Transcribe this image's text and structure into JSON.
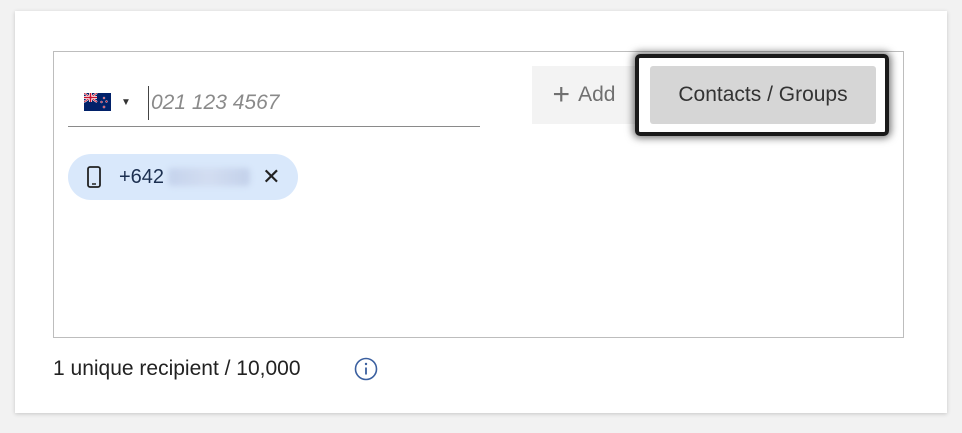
{
  "phone_input": {
    "country_flag": "new-zealand-flag-icon",
    "placeholder": "021 123 4567"
  },
  "add_button": {
    "icon": "plus-icon",
    "label": "Add"
  },
  "contacts_button": {
    "label": "Contacts / Groups"
  },
  "recipients": [
    {
      "icon": "mobile-phone-icon",
      "number": "+642"
    }
  ],
  "footer": {
    "count_text": "1 unique recipient / 10,000",
    "info_icon": "info-icon"
  },
  "colors": {
    "chip_bg": "#d9e8fb",
    "highlight_border": "#1a1a1a",
    "info_icon": "#3a5f9f"
  }
}
